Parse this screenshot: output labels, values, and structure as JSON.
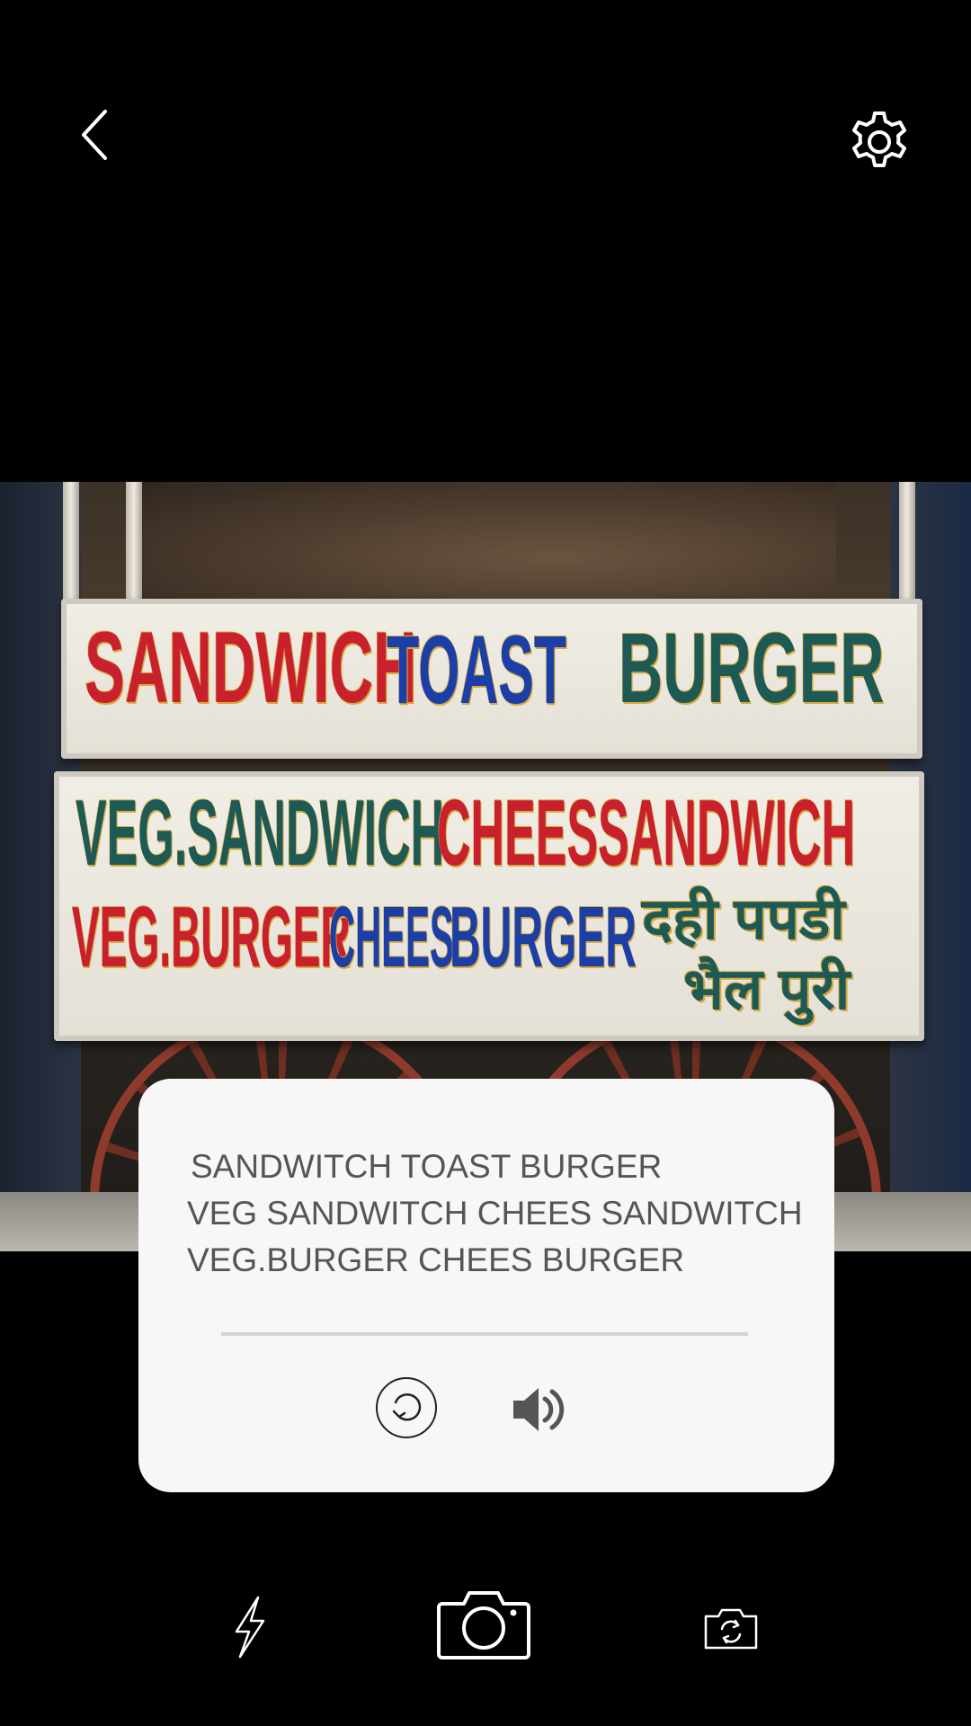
{
  "icons": {
    "back": "chevron-left-icon",
    "settings": "gear-icon",
    "refresh": "refresh-icon",
    "speaker": "speaker-icon",
    "flash": "flash-icon",
    "shutter": "camera-icon",
    "switch_camera": "switch-camera-icon"
  },
  "photo": {
    "sign_top": {
      "word1": "SANDWICH",
      "word2": "TOAST",
      "word3": "BURGER"
    },
    "sign_bottom": {
      "line1_word1": "VEG.SANDWICH",
      "line1_word2": "CHEESSANDWICH",
      "line2_word1": "VEG.BURGER",
      "line2_word2": "CHEES",
      "line2_word3": "BURGER",
      "hindi_line1": "दही पपडी",
      "hindi_line2": "भैल पुरी"
    }
  },
  "result": {
    "lines": [
      "SANDWITCH TOAST BURGER",
      "VEG SANDWITCH CHEES SANDWITCH",
      "VEG.BURGER CHEES BURGER"
    ]
  },
  "colors": {
    "background": "#000000",
    "card": "#f7f7f7",
    "result_text": "#555555",
    "icon_white": "#ffffff",
    "icon_dark": "#555555"
  }
}
